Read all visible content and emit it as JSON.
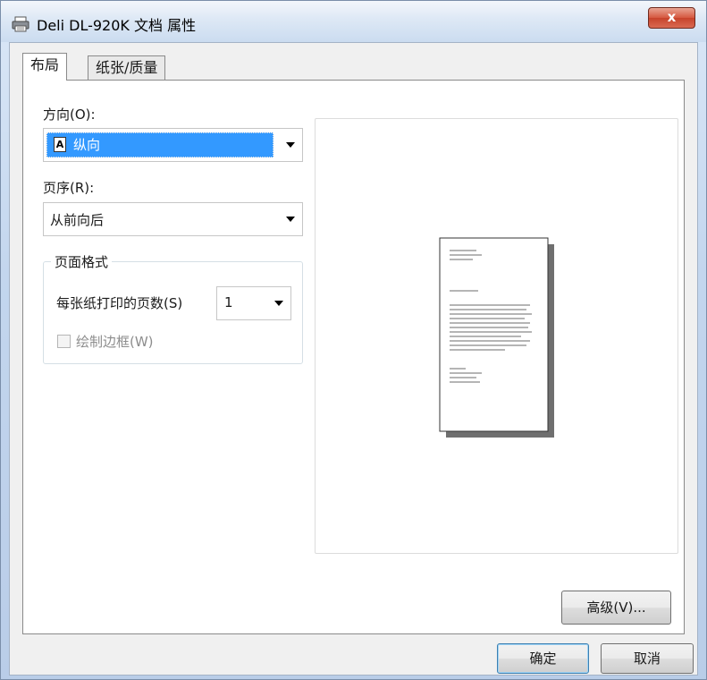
{
  "window": {
    "title": "Deli DL-920K 文档 属性",
    "close_glyph": "x"
  },
  "tabs": [
    {
      "label": "布局",
      "active": true
    },
    {
      "label": "纸张/质量",
      "active": false
    }
  ],
  "layout": {
    "orientation": {
      "label": "方向(O):",
      "value": "纵向",
      "icon_glyph": "A",
      "icon": "portrait-page-icon"
    },
    "page_order": {
      "label": "页序(R):",
      "value": "从前向后"
    },
    "page_format": {
      "title": "页面格式",
      "pages_per_sheet_label": "每张纸打印的页数(S)",
      "pages_per_sheet_value": "1",
      "draw_borders_label": "绘制边框(W)",
      "draw_borders_checked": false
    }
  },
  "buttons": {
    "advanced": "高级(V)...",
    "ok": "确定",
    "cancel": "取消"
  },
  "colors": {
    "selection": "#3399ff",
    "close_button": "#c7432b"
  }
}
